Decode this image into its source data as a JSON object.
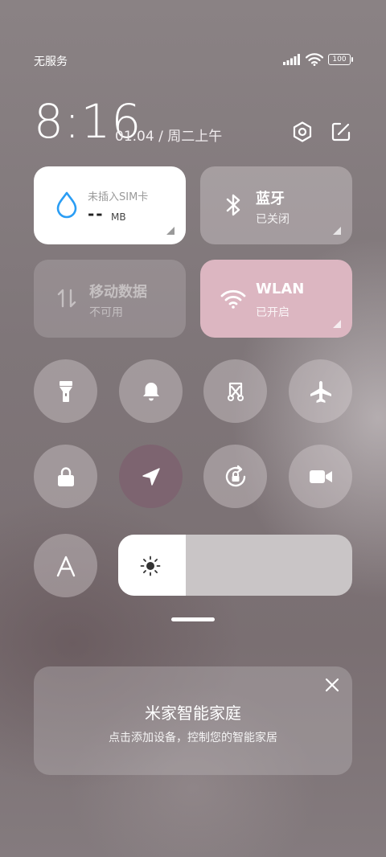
{
  "status": {
    "carrier": "无服务",
    "battery": "100"
  },
  "header": {
    "time": "8:16",
    "date": "01.04 / 周二上午"
  },
  "tiles": {
    "sim": {
      "title": "未插入SIM卡",
      "value": "--",
      "unit": "MB"
    },
    "bluetooth": {
      "title": "蓝牙",
      "subtitle": "已关闭"
    },
    "mobile_data": {
      "title": "移动数据",
      "subtitle": "不可用"
    },
    "wlan": {
      "title": "WLAN",
      "subtitle": "已开启"
    }
  },
  "toggles": [
    {
      "icon": "flashlight-icon",
      "active": false
    },
    {
      "icon": "bell-icon",
      "active": false
    },
    {
      "icon": "screenshot-icon",
      "active": false
    },
    {
      "icon": "airplane-icon",
      "active": false
    },
    {
      "icon": "lock-icon",
      "active": false
    },
    {
      "icon": "location-icon",
      "active": true
    },
    {
      "icon": "rotation-lock-icon",
      "active": false
    },
    {
      "icon": "video-camera-icon",
      "active": false
    },
    {
      "icon": "auto-brightness-icon",
      "active": false
    }
  ],
  "brightness": {
    "level": 0.29
  },
  "smart_home_card": {
    "title": "米家智能家庭",
    "subtitle": "点击添加设备，控制您的智能家居"
  },
  "colors": {
    "wlan_active": "#dcb6c1",
    "location_active": "#7d6470",
    "water_drop": "#2a9df4"
  }
}
